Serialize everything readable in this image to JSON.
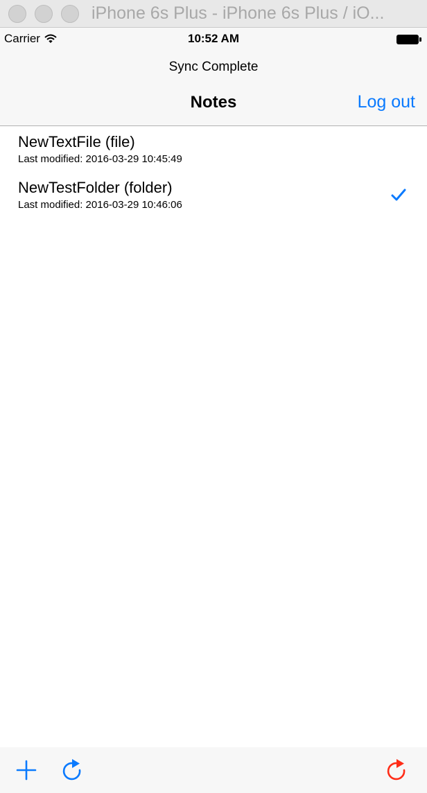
{
  "window": {
    "title": "iPhone 6s Plus - iPhone 6s Plus / iO..."
  },
  "status_bar": {
    "carrier": "Carrier",
    "time": "10:52 AM",
    "signal_icon": "wifi-icon",
    "battery_icon": "battery-icon"
  },
  "nav_bar": {
    "prompt": "Sync Complete",
    "title": "Notes",
    "right_button": "Log out"
  },
  "items": [
    {
      "title": "NewTextFile  (file)",
      "subtitle": "Last modified: 2016-03-29 10:45:49",
      "checked": false
    },
    {
      "title": "NewTestFolder  (folder)",
      "subtitle": "Last modified: 2016-03-29 10:46:06",
      "checked": true
    }
  ],
  "toolbar": {
    "add_icon": "plus-icon",
    "refresh_icon": "refresh-icon",
    "sync_icon": "sync-icon"
  },
  "colors": {
    "tint": "#0a7afe",
    "sync_red": "#ff2d18",
    "bar_background": "#f7f7f7"
  }
}
